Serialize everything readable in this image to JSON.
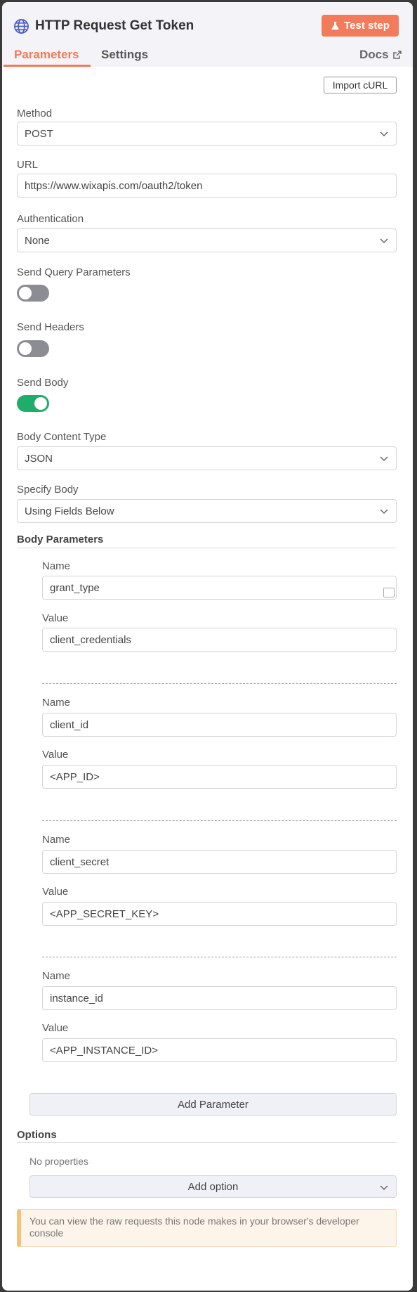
{
  "header": {
    "title": "HTTP Request Get Token",
    "test_step": "Test step",
    "tabs": {
      "parameters": "Parameters",
      "settings": "Settings",
      "docs": "Docs"
    }
  },
  "import_curl": "Import cURL",
  "method": {
    "label": "Method",
    "value": "POST"
  },
  "url": {
    "label": "URL",
    "value": "https://www.wixapis.com/oauth2/token"
  },
  "authentication": {
    "label": "Authentication",
    "value": "None"
  },
  "send_query_parameters": {
    "label": "Send Query Parameters",
    "enabled": false
  },
  "send_headers": {
    "label": "Send Headers",
    "enabled": false
  },
  "send_body": {
    "label": "Send Body",
    "enabled": true
  },
  "body_content_type": {
    "label": "Body Content Type",
    "value": "JSON"
  },
  "specify_body": {
    "label": "Specify Body",
    "value": "Using Fields Below"
  },
  "body_parameters": {
    "label": "Body Parameters",
    "name_label": "Name",
    "value_label": "Value",
    "items": [
      {
        "name": "grant_type",
        "value": "client_credentials"
      },
      {
        "name": "client_id",
        "value": "<APP_ID>"
      },
      {
        "name": "client_secret",
        "value": "<APP_SECRET_KEY>"
      },
      {
        "name": "instance_id",
        "value": "<APP_INSTANCE_ID>"
      }
    ],
    "add_parameter": "Add Parameter"
  },
  "options": {
    "label": "Options",
    "empty_text": "No properties",
    "add_option": "Add option"
  },
  "notice": "You can view the raw requests this node makes in your browser's developer console",
  "colors": {
    "accent": "#f47a5c",
    "toggle_on": "#1fae6a",
    "toggle_off": "#8c8c94",
    "globe_icon": "#4a5fc1"
  }
}
